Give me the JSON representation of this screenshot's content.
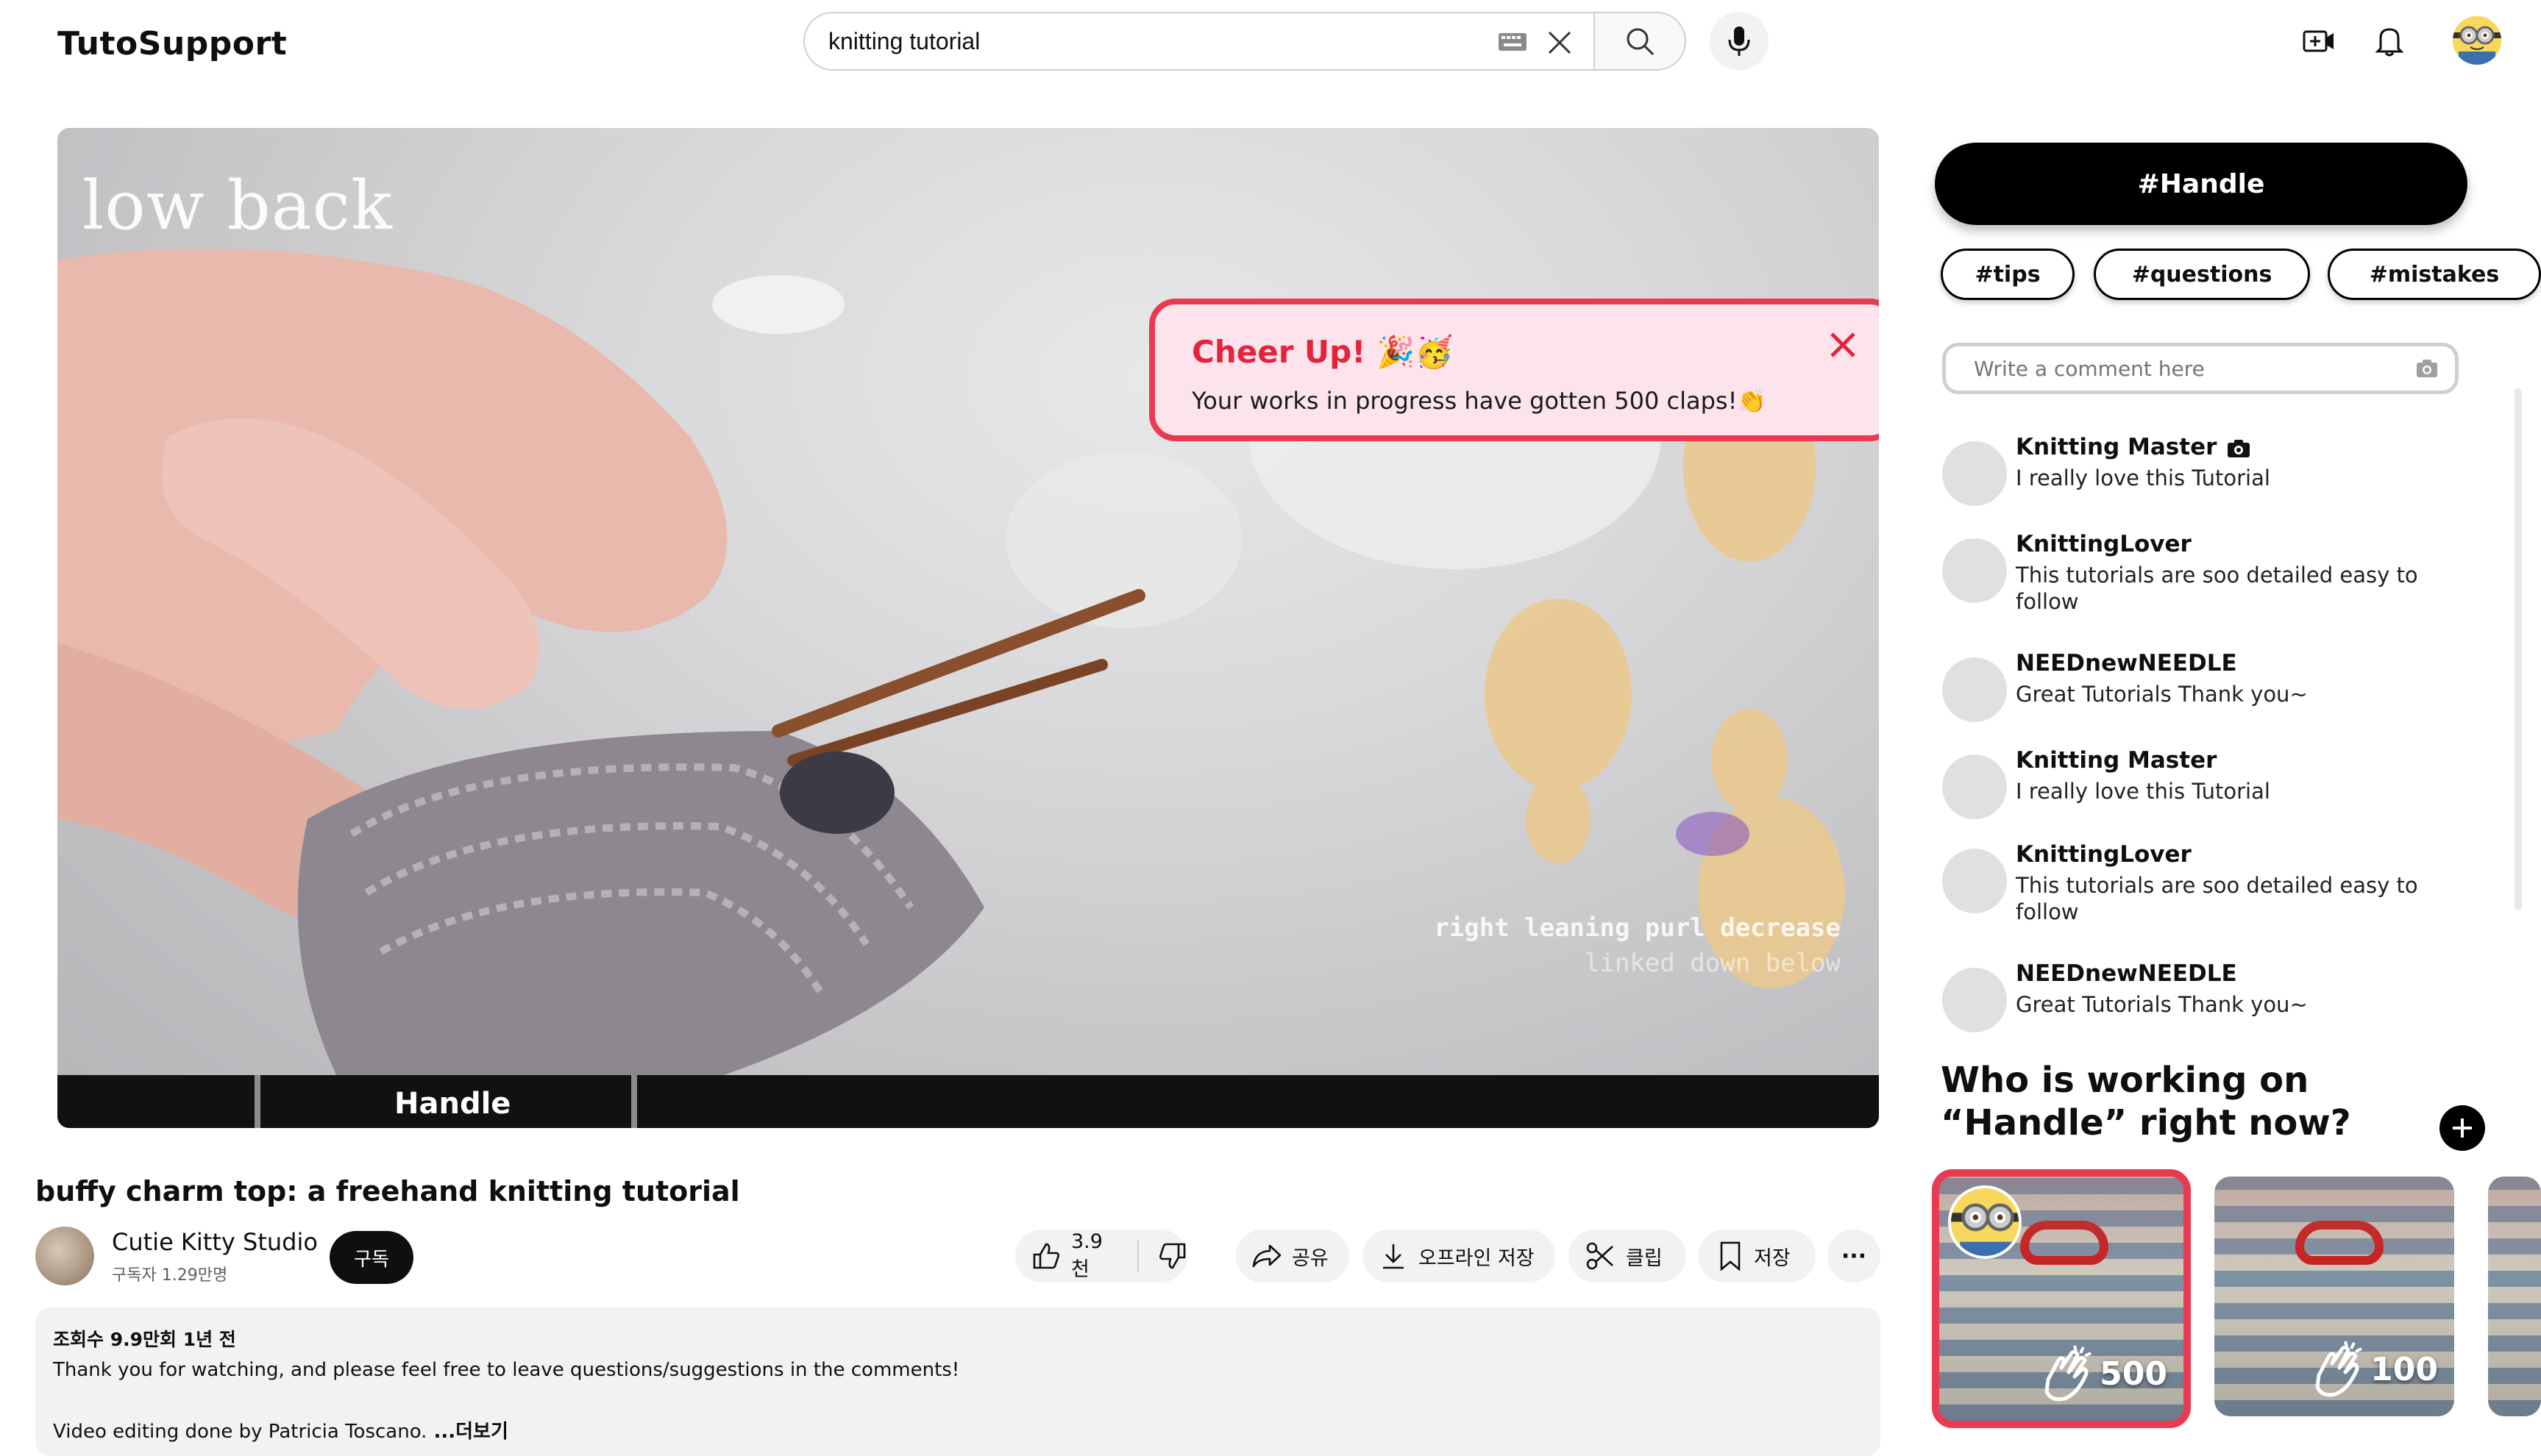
{
  "app": {
    "logo": "TutoSupport"
  },
  "search": {
    "query": "knitting tutorial"
  },
  "video": {
    "overlay_title": "low back",
    "caption_line1": "right leaning purl decrease",
    "caption_line2": "linked down below",
    "chapter_label": "Handle"
  },
  "toast": {
    "title": "Cheer Up! 🎉🥳",
    "body": "Your works in progress have gotten 500 claps!👏"
  },
  "meta": {
    "title": "buffy charm top: a freehand knitting tutorial",
    "channel_name": "Cutie Kitty Studio",
    "channel_subs": "구독자 1.29만명",
    "subscribe_label": "구독",
    "like_count": "3.9천",
    "share_label": "공유",
    "download_label": "오프라인 저장",
    "clip_label": "클립",
    "save_label": "저장",
    "more_label": "···"
  },
  "description": {
    "meta": "조회수 9.9만회  1년 전",
    "line1": "Thank you for watching, and please feel free to leave questions/suggestions in the comments!",
    "line2": "Video editing done by Patricia Toscano.",
    "more": " ...더보기"
  },
  "panel": {
    "handle_button": "#Handle",
    "tags": [
      "#tips",
      "#questions",
      "#mistakes"
    ],
    "comment_placeholder": "Write a comment here",
    "comments": [
      {
        "name": "Knitting Master",
        "text": "I really love this Tutorial",
        "has_camera_icon": true
      },
      {
        "name": "KnittingLover",
        "text": "This tutorials are soo detailed easy to follow"
      },
      {
        "name": "NEEDnewNEEDLE",
        "text": "Great Tutorials Thank you~"
      },
      {
        "name": "Knitting Master",
        "text": "I really love this Tutorial"
      },
      {
        "name": "KnittingLover",
        "text": "This tutorials are soo detailed easy to follow"
      },
      {
        "name": "NEEDnewNEEDLE",
        "text": "Great Tutorials Thank you~"
      }
    ],
    "who_title": "Who is working on “Handle” right now?",
    "cards": [
      {
        "claps": "500",
        "selected": true
      },
      {
        "claps": "100",
        "selected": false
      }
    ]
  },
  "colors": {
    "accent_red": "#ea3a52",
    "toast_bg": "#fde4ec"
  }
}
